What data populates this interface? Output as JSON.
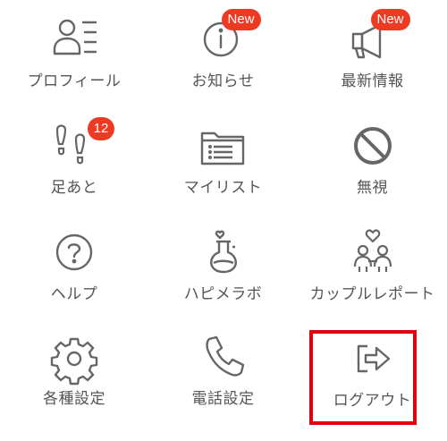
{
  "menu": {
    "items": [
      {
        "label": "プロフィール",
        "icon": "profile-card-icon"
      },
      {
        "label": "お知らせ",
        "icon": "info-icon",
        "badge": "New"
      },
      {
        "label": "最新情報",
        "icon": "megaphone-icon",
        "badge": "New"
      },
      {
        "label": "足あと",
        "icon": "footprints-icon",
        "badge": "12"
      },
      {
        "label": "マイリスト",
        "icon": "folder-list-icon"
      },
      {
        "label": "無視",
        "icon": "prohibited-icon"
      },
      {
        "label": "ヘルプ",
        "icon": "help-icon"
      },
      {
        "label": "ハピメラボ",
        "icon": "flask-heart-icon"
      },
      {
        "label": "カップルレポート",
        "icon": "couple-heart-icon"
      },
      {
        "label": "各種設定",
        "icon": "gear-icon"
      },
      {
        "label": "電話設定",
        "icon": "phone-icon"
      },
      {
        "label": "ログアウト",
        "icon": "logout-icon"
      }
    ]
  },
  "colors": {
    "icon_stroke": "#666666",
    "label_text": "#555555",
    "badge_bg": "#ee3a22",
    "badge_text": "#ffffff",
    "highlight_border": "#e1000f"
  }
}
